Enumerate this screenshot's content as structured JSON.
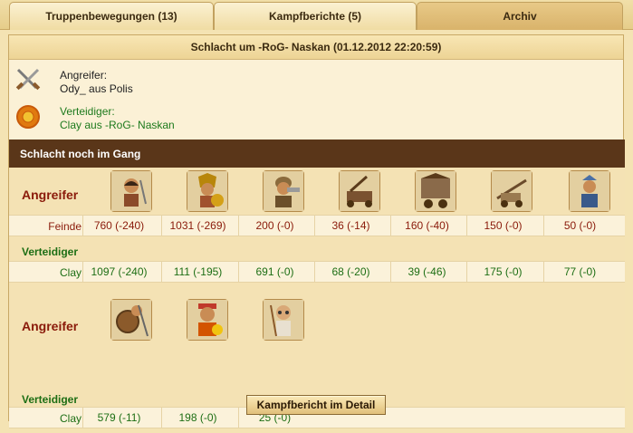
{
  "tabs": [
    {
      "label": "Truppenbewegungen (13)"
    },
    {
      "label": "Kampfberichte (5)"
    },
    {
      "label": "Archiv"
    }
  ],
  "report": {
    "title": "Schlacht um -RoG- Naskan (01.12.2012 22:20:59)",
    "attacker_label": "Angreifer:",
    "attacker_value": "Ody_ aus Polis",
    "defender_label": "Verteidiger:",
    "defender_value": "Clay aus -RoG- Naskan",
    "status": "Schlacht noch im Gang"
  },
  "land": {
    "attacker_heading": "Angreifer",
    "enemy_label": "Feinde",
    "enemy_values": [
      "760 (-240)",
      "1031 (-269)",
      "200 (-0)",
      "36 (-14)",
      "160 (-40)",
      "150 (-0)",
      "50 (-0)"
    ],
    "defender_heading": "Verteidiger",
    "own_label": "Clay",
    "own_values": [
      "1097 (-240)",
      "111 (-195)",
      "691 (-0)",
      "68 (-20)",
      "39 (-46)",
      "175 (-0)",
      "77 (-0)"
    ],
    "unit_icons": [
      "swordsman-icon",
      "hoplite-icon",
      "slinger-icon",
      "catapult-icon",
      "chariot-icon",
      "horseman-icon",
      "archer-icon"
    ]
  },
  "sea": {
    "attacker_heading": "Angreifer",
    "defender_heading": "Verteidiger",
    "own_label": "Clay",
    "own_values": [
      "579 (-11)",
      "198 (-0)",
      "25 (-0)"
    ],
    "unit_icons": [
      "shield-warrior-icon",
      "hero-warrior-icon",
      "elder-sage-icon"
    ]
  },
  "detail_button_label": "Kampfbericht im Detail"
}
